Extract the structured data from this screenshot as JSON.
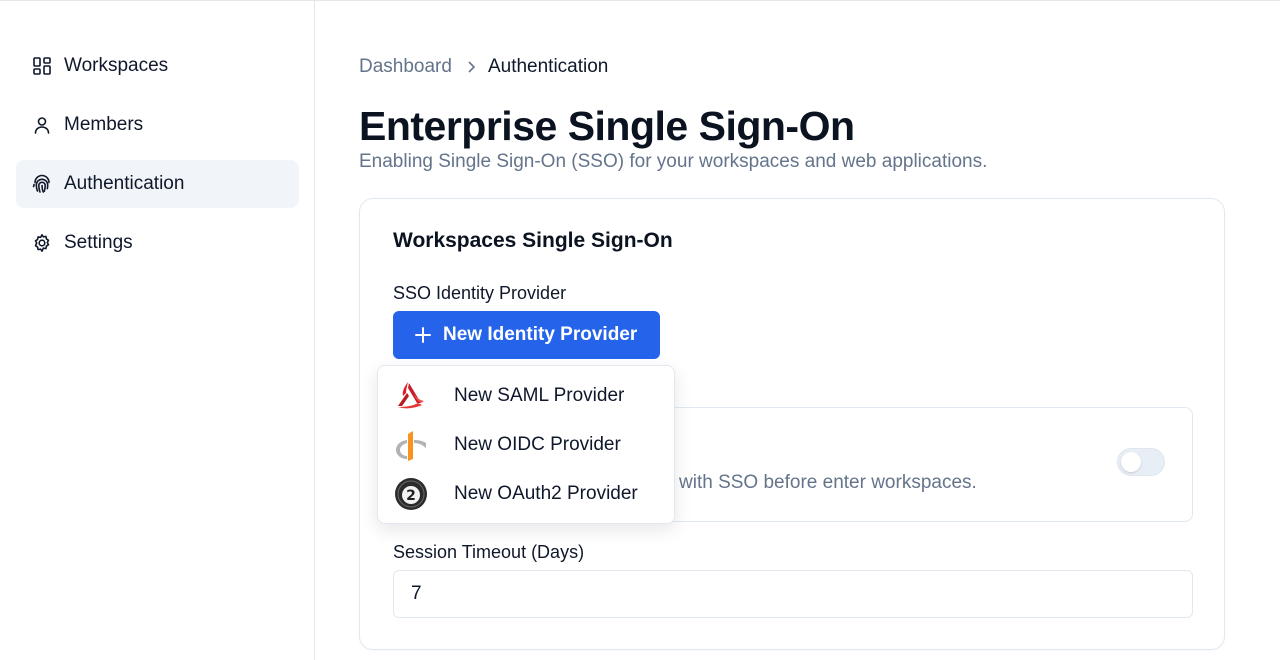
{
  "sidebar": {
    "items": [
      {
        "label": "Workspaces",
        "icon": "grid-icon"
      },
      {
        "label": "Members",
        "icon": "user-icon"
      },
      {
        "label": "Authentication",
        "icon": "fingerprint-icon",
        "active": true
      },
      {
        "label": "Settings",
        "icon": "gear-icon"
      }
    ]
  },
  "breadcrumb": {
    "parent": "Dashboard",
    "current": "Authentication"
  },
  "page": {
    "title": "Enterprise Single Sign-On",
    "subtitle": "Enabling Single Sign-On (SSO) for your workspaces and web applications."
  },
  "card": {
    "title": "Workspaces Single Sign-On",
    "provider_label": "SSO Identity Provider",
    "new_provider_button": "New Identity Provider",
    "enforce_description_visible": "with SSO before enter workspaces.",
    "enforce_toggle_on": false,
    "session_timeout_label": "Session Timeout (Days)",
    "session_timeout_value": "7"
  },
  "dropdown": {
    "items": [
      {
        "label": "New SAML Provider",
        "icon": "saml-logo-icon"
      },
      {
        "label": "New OIDC Provider",
        "icon": "openid-logo-icon"
      },
      {
        "label": "New OAuth2 Provider",
        "icon": "oauth2-logo-icon"
      }
    ]
  },
  "colors": {
    "accent": "#2563eb",
    "muted_text": "#64748b",
    "active_nav_bg": "#f1f5f9",
    "border": "#e2e8f0"
  }
}
